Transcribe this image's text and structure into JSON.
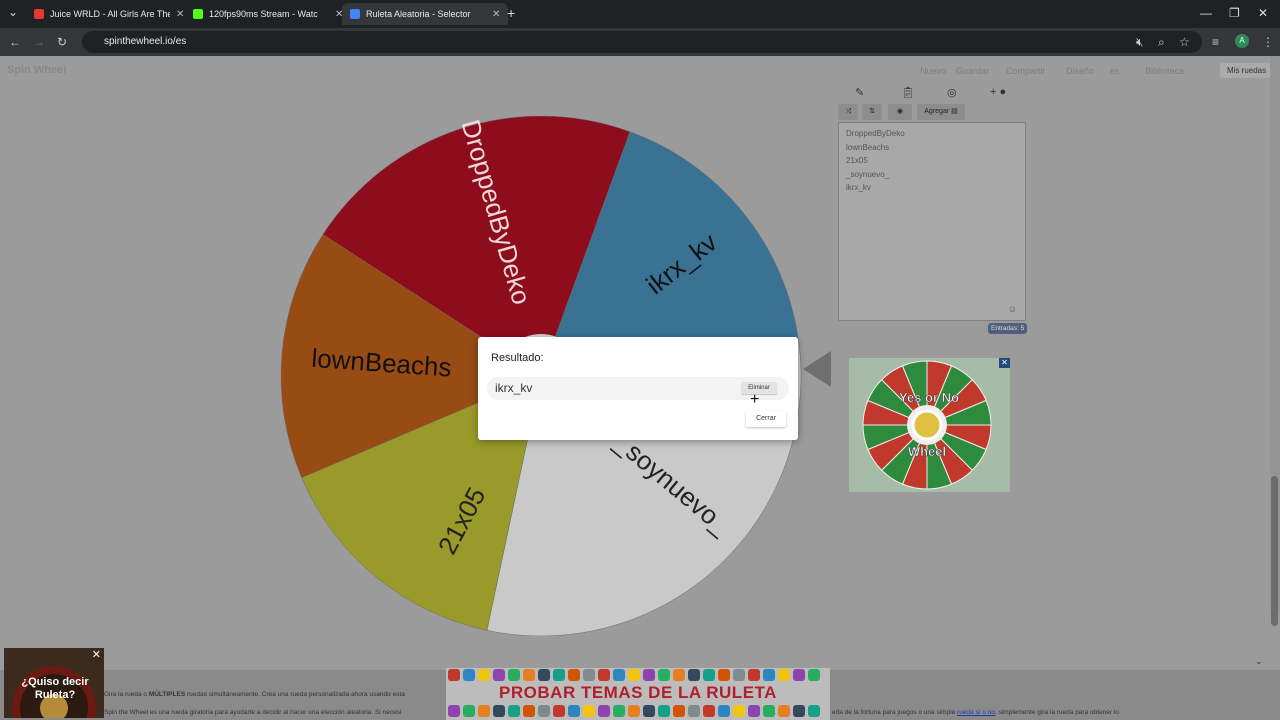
{
  "browser": {
    "tabs": [
      {
        "title": "Juice WRLD - All Girls Are The S",
        "color": "#e53935"
      },
      {
        "title": "120fps90ms Stream - Watc",
        "color": "#53fc18"
      },
      {
        "title": "Ruleta Aleatoria - Selector",
        "color": "#4285f4"
      }
    ],
    "url": "spinthewheel.io/es"
  },
  "site": {
    "logo": "Spin Wheel",
    "nav": [
      "Nuevo",
      "Guardar",
      "Compartir",
      "Diseño",
      "es",
      "Biblioteca"
    ],
    "my_wheels": "Mis ruedas"
  },
  "wheel": {
    "segments": [
      {
        "label": "DroppedByDeko",
        "color": "#8e0d1d"
      },
      {
        "label": "ikrx_kv",
        "color": "#3a7293"
      },
      {
        "label": "_soynuevo_",
        "color": "#c9c9c9"
      },
      {
        "label": "21x05",
        "color": "#9a9a2a"
      },
      {
        "label": "lownBeachs",
        "color": "#984c13"
      }
    ]
  },
  "panel": {
    "add_label": "Agregar",
    "entries": [
      "DroppedByDeko",
      "lownBeachs",
      "21x05",
      "_soynuevo_",
      "ikrx_kv"
    ],
    "entries_count": "Entradas: 5"
  },
  "dialog": {
    "title": "Resultado:",
    "result": "ikrx_kv",
    "remove_label": "Eliminar",
    "close_label": "Cerrar"
  },
  "ads": {
    "roulette_text": "¿Quiso decir Ruleta?",
    "themes_text": "PROBAR TEMAS DE LA RULETA",
    "yes_or_no": "Yes or No",
    "wheel_word": "Wheel"
  },
  "footer": {
    "line1_a": "Gira la rueda o ",
    "line1_b": "MÚLTIPLES",
    "line1_c": " ruedas simultáneamente. Crea una rueda personalizada ahora usando esta",
    "line2": "Spin the Wheel es una rueda giratoria para ayudarte a decidir al hacer una elección aleatoria. Si necesi",
    "line2_right": "eda de la fortuna para juegos o una simple ",
    "line2_link": "rueda sí o no",
    "line2_end": ", simplemente gira la rueda para obtener lo"
  }
}
